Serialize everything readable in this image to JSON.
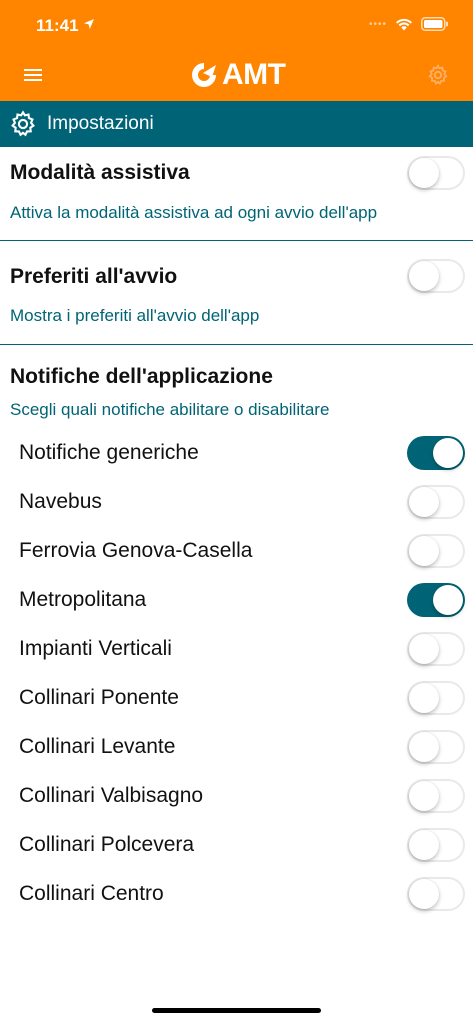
{
  "status_bar": {
    "time": "11:41"
  },
  "app_bar": {
    "logo_text": "AMT"
  },
  "section": {
    "title": "Impostazioni"
  },
  "settings": {
    "assistive": {
      "title": "Modalità assistiva",
      "description": "Attiva la modalità assistiva ad ogni avvio dell'app",
      "enabled": false
    },
    "favorites": {
      "title": "Preferiti all'avvio",
      "description": "Mostra i preferiti all'avvio dell'app",
      "enabled": false
    },
    "notifications": {
      "title": "Notifiche dell'applicazione",
      "description": "Scegli quali notifiche abilitare o disabilitare",
      "items": [
        {
          "label": "Notifiche generiche",
          "enabled": true
        },
        {
          "label": "Navebus",
          "enabled": false
        },
        {
          "label": "Ferrovia Genova-Casella",
          "enabled": false
        },
        {
          "label": "Metropolitana",
          "enabled": true
        },
        {
          "label": "Impianti Verticali",
          "enabled": false
        },
        {
          "label": "Collinari Ponente",
          "enabled": false
        },
        {
          "label": "Collinari Levante",
          "enabled": false
        },
        {
          "label": "Collinari Valbisagno",
          "enabled": false
        },
        {
          "label": "Collinari Polcevera",
          "enabled": false
        },
        {
          "label": "Collinari Centro",
          "enabled": false
        }
      ]
    }
  },
  "colors": {
    "app_bar": "#FF8500",
    "accent": "#006476"
  }
}
